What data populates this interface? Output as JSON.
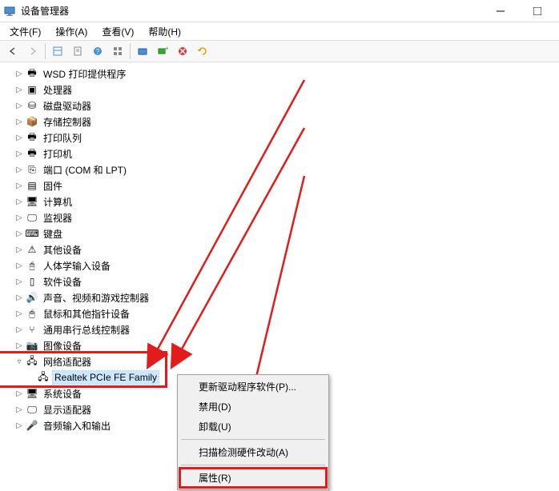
{
  "title": "设备管理器",
  "menubar": {
    "file": "文件(F)",
    "action": "操作(A)",
    "view": "查看(V)",
    "help": "帮助(H)"
  },
  "tree": {
    "wsd": "WSD 打印提供程序",
    "cpu": "处理器",
    "disk": "磁盘驱动器",
    "storage": "存储控制器",
    "printqueue": "打印队列",
    "printer": "打印机",
    "ports": "端口 (COM 和 LPT)",
    "firmware": "固件",
    "computer": "计算机",
    "monitor": "监视器",
    "keyboard": "键盘",
    "other": "其他设备",
    "hid": "人体学输入设备",
    "software": "软件设备",
    "sound": "声音、视频和游戏控制器",
    "mouse": "鼠标和其他指针设备",
    "usb": "通用串行总线控制器",
    "imaging": "图像设备",
    "network": "网络适配器",
    "network_child": "Realtek PCIe FE Family",
    "system": "系统设备",
    "display": "显示适配器",
    "audio": "音频输入和输出"
  },
  "context": {
    "update": "更新驱动程序软件(P)...",
    "disable": "禁用(D)",
    "uninstall": "卸载(U)",
    "scan": "扫描检测硬件改动(A)",
    "properties": "属性(R)"
  }
}
